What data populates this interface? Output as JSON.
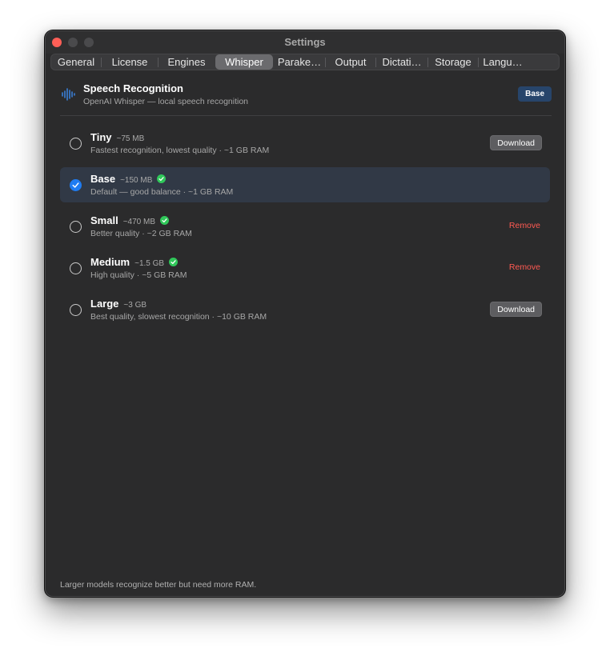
{
  "window": {
    "title": "Settings"
  },
  "tabs": [
    {
      "label": "General",
      "active": false
    },
    {
      "label": "License",
      "active": false
    },
    {
      "label": "Engines",
      "active": false
    },
    {
      "label": "Whisper",
      "active": true
    },
    {
      "label": "Parake…",
      "active": false
    },
    {
      "label": "Output",
      "active": false
    },
    {
      "label": "Dictati…",
      "active": false
    },
    {
      "label": "Storage",
      "active": false
    },
    {
      "label": "Langu…",
      "active": false
    }
  ],
  "header": {
    "icon": "waveform-icon",
    "title": "Speech Recognition",
    "subtitle": "OpenAI Whisper — local speech recognition",
    "badge": "Base"
  },
  "models": [
    {
      "name": "Tiny",
      "size": "~75 MB",
      "installed": false,
      "selected": false,
      "description": "Fastest recognition, lowest quality · ~1 GB RAM",
      "action": "Download"
    },
    {
      "name": "Base",
      "size": "~150 MB",
      "installed": true,
      "selected": true,
      "description": "Default — good balance · ~1 GB RAM",
      "action": ""
    },
    {
      "name": "Small",
      "size": "~470 MB",
      "installed": true,
      "selected": false,
      "description": "Better quality · ~2 GB RAM",
      "action": "Remove"
    },
    {
      "name": "Medium",
      "size": "~1.5 GB",
      "installed": true,
      "selected": false,
      "description": "High quality · ~5 GB RAM",
      "action": "Remove"
    },
    {
      "name": "Large",
      "size": "~3 GB",
      "installed": false,
      "selected": false,
      "description": "Best quality, slowest recognition · ~10 GB RAM",
      "action": "Download"
    }
  ],
  "footer": {
    "note": "Larger models recognize better but need more RAM."
  },
  "colors": {
    "accent": "#1f7cf2",
    "installed": "#30c85a",
    "remove": "#ff5a52",
    "badge": "#27456b",
    "close": "#ff5f57"
  }
}
